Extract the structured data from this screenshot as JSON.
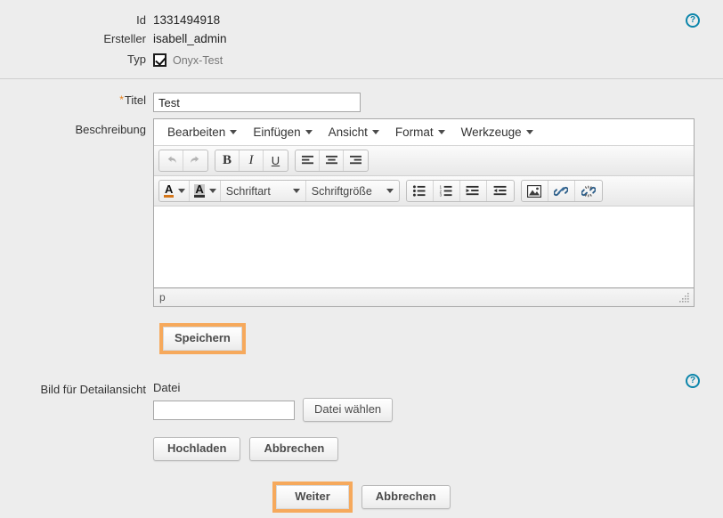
{
  "meta": {
    "fields": [
      {
        "label": "Id",
        "value": "1331494918"
      },
      {
        "label": "Ersteller",
        "value": "isabell_admin"
      }
    ],
    "type_label": "Typ",
    "type_checkbox_label": "Onyx-Test",
    "type_checked": true
  },
  "title_field": {
    "label": "Titel",
    "required_marker": "*",
    "value": "Test"
  },
  "description": {
    "label": "Beschreibung",
    "menubar": [
      {
        "label": "Bearbeiten"
      },
      {
        "label": "Einfügen"
      },
      {
        "label": "Ansicht"
      },
      {
        "label": "Format"
      },
      {
        "label": "Werkzeuge"
      }
    ],
    "toolbar_row1": [
      {
        "name": "undo-icon",
        "title": "Rückgängig"
      },
      {
        "name": "redo-icon",
        "title": "Wiederholen"
      },
      {
        "name": "bold-icon",
        "title": "Fett",
        "glyph": "B"
      },
      {
        "name": "italic-icon",
        "title": "Kursiv",
        "glyph": "I"
      },
      {
        "name": "underline-icon",
        "title": "Unterstrichen",
        "glyph": "U"
      },
      {
        "name": "align-left-icon",
        "title": "Linksbündig"
      },
      {
        "name": "align-center-icon",
        "title": "Zentriert"
      },
      {
        "name": "align-right-icon",
        "title": "Rechtsbündig"
      }
    ],
    "toolbar_row2": {
      "text_color_label": "A",
      "background_color_label": "A",
      "font_family": "Schriftart",
      "font_size": "Schriftgröße",
      "list_buttons": [
        {
          "name": "bullet-list-icon",
          "title": "Aufzählung"
        },
        {
          "name": "numbered-list-icon",
          "title": "Nummerierte Liste"
        },
        {
          "name": "indent-icon",
          "title": "Einzug vergrößern"
        },
        {
          "name": "outdent-icon",
          "title": "Einzug verkleinern"
        }
      ],
      "insert_buttons": [
        {
          "name": "image-icon",
          "title": "Bild einfügen"
        },
        {
          "name": "link-icon",
          "title": "Link einfügen"
        },
        {
          "name": "unlink-icon",
          "title": "Link entfernen"
        }
      ]
    },
    "content": "",
    "statusbar_path": "p"
  },
  "save_button": {
    "label": "Speichern",
    "highlighted": true
  },
  "upload": {
    "label": "Bild für Detailansicht",
    "file_label": "Datei",
    "file_value": "",
    "choose_button": "Datei wählen",
    "upload_button": "Hochladen",
    "cancel_button": "Abbrechen"
  },
  "footer": {
    "next_button": "Weiter",
    "cancel_button": "Abbrechen",
    "next_highlighted": true
  },
  "help": {
    "glyph": "?",
    "top_title": "Hilfe",
    "bottom_title": "Hilfe"
  },
  "colors": {
    "page_background": "#ededed",
    "accent_highlight": "#f6a95c",
    "help_icon": "#0d86ab",
    "required_star": "#e8811c",
    "text": "#333333"
  }
}
